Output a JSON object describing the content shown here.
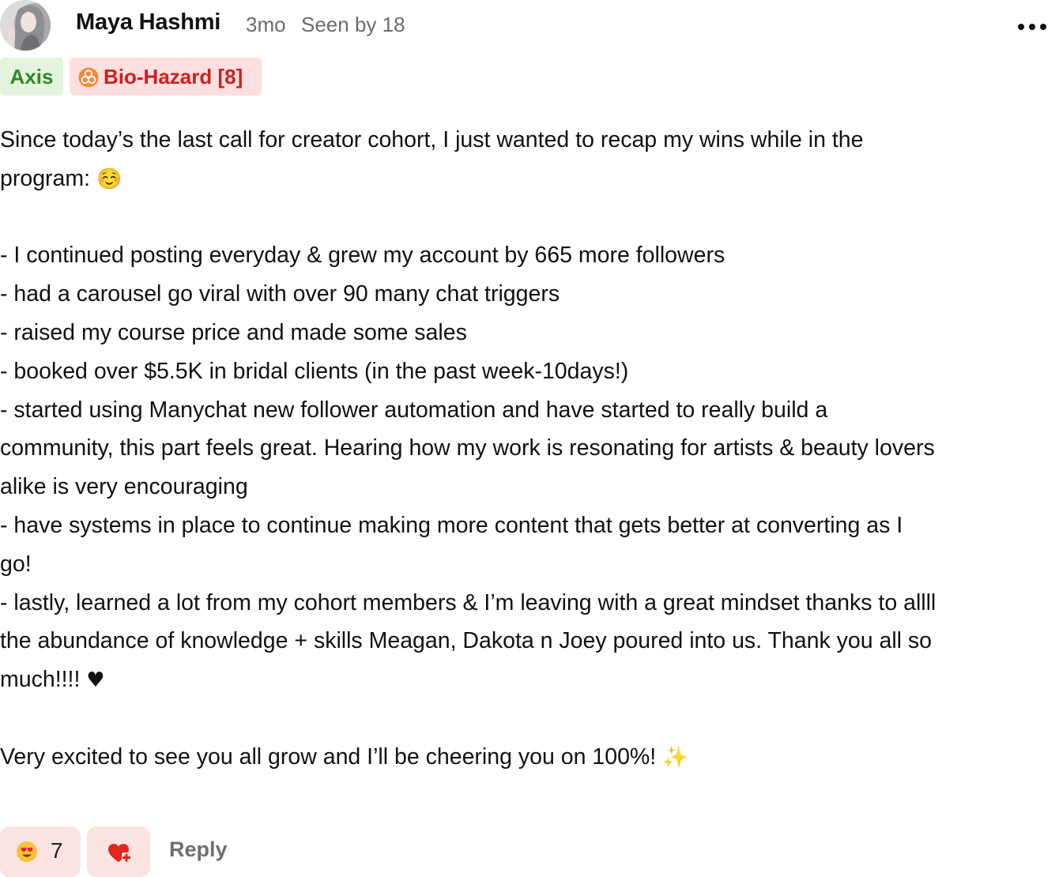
{
  "post": {
    "author": "Maya Hashmi",
    "time_ago": "3mo",
    "seen_by": "Seen by 18",
    "more_icon": "more-horizontal-icon"
  },
  "badges": {
    "axis": "Axis",
    "bio_hazard": "Bio-Hazard [8]",
    "bio_hazard_icon": "biohazard-icon",
    "colors": {
      "axis_text": "#2e8a22",
      "axis_bg": "#e3f3dd",
      "bio_text": "#d31d1d",
      "bio_bg": "#fbe0df",
      "bio_icon": "#f08a3c"
    }
  },
  "content": {
    "lines": [
      "Since today’s the last call for creator cohort, I just wanted to recap my wins while in the",
      "program:",
      "",
      "- I continued posting everyday & grew my account by 665 more followers",
      "- had a carousel go viral with over 90 many chat triggers",
      "- raised my course price and made some sales",
      "- booked over $5.5K in bridal clients (in the past week-10days!)",
      "- started using Manychat new follower automation and have started to really build a",
      "community, this part feels great. Hearing how my work is resonating for artists & beauty lovers",
      "alike is very encouraging",
      "- have systems in place to continue making more content that gets better at converting as I",
      "go!",
      "- lastly, learned a lot from my cohort members & I’m leaving with a great mindset thanks to allll",
      "the abundance of knowledge + skills Meagan, Dakota n Joey poured into us. Thank you all so",
      "much!!!!",
      "",
      "Very excited to see you all grow and I’ll be cheering you on 100%!"
    ],
    "emojis": {
      "smiling_face": "☺️",
      "black_heart": "♥",
      "sparkles": "✨"
    }
  },
  "footer": {
    "reaction_emoji": "heart-eyes-emoji",
    "reaction_count": "7",
    "add_reaction_icon": "heart-plus-icon",
    "reply_label": "Reply",
    "colors": {
      "reaction_bg": "#fbe3e1",
      "add_reaction": "#e0261d"
    }
  }
}
